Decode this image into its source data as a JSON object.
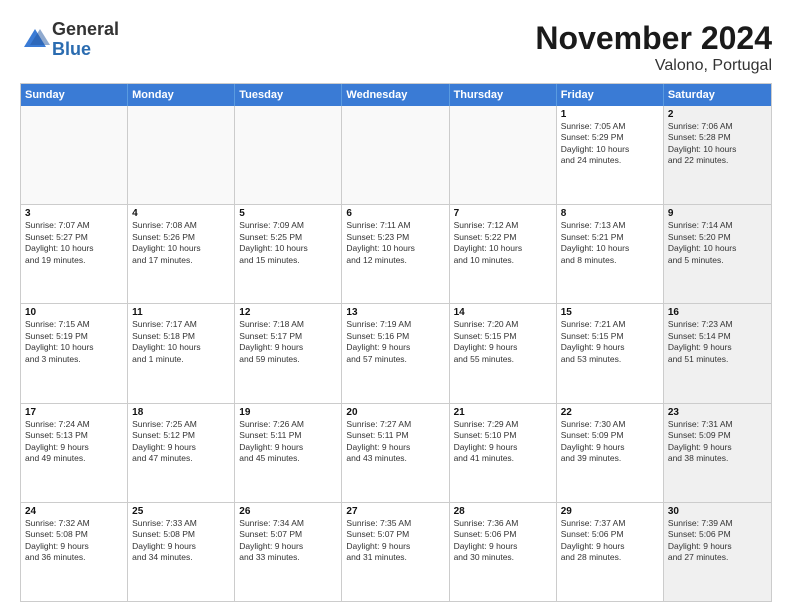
{
  "header": {
    "logo_general": "General",
    "logo_blue": "Blue",
    "month_title": "November 2024",
    "subtitle": "Valono, Portugal"
  },
  "days": [
    "Sunday",
    "Monday",
    "Tuesday",
    "Wednesday",
    "Thursday",
    "Friday",
    "Saturday"
  ],
  "rows": [
    [
      {
        "day": "",
        "empty": true
      },
      {
        "day": "",
        "empty": true
      },
      {
        "day": "",
        "empty": true
      },
      {
        "day": "",
        "empty": true
      },
      {
        "day": "",
        "empty": true
      },
      {
        "day": "1",
        "info": "Sunrise: 7:05 AM\nSunset: 5:29 PM\nDaylight: 10 hours\nand 24 minutes."
      },
      {
        "day": "2",
        "info": "Sunrise: 7:06 AM\nSunset: 5:28 PM\nDaylight: 10 hours\nand 22 minutes.",
        "shaded": true
      }
    ],
    [
      {
        "day": "3",
        "info": "Sunrise: 7:07 AM\nSunset: 5:27 PM\nDaylight: 10 hours\nand 19 minutes."
      },
      {
        "day": "4",
        "info": "Sunrise: 7:08 AM\nSunset: 5:26 PM\nDaylight: 10 hours\nand 17 minutes."
      },
      {
        "day": "5",
        "info": "Sunrise: 7:09 AM\nSunset: 5:25 PM\nDaylight: 10 hours\nand 15 minutes."
      },
      {
        "day": "6",
        "info": "Sunrise: 7:11 AM\nSunset: 5:23 PM\nDaylight: 10 hours\nand 12 minutes."
      },
      {
        "day": "7",
        "info": "Sunrise: 7:12 AM\nSunset: 5:22 PM\nDaylight: 10 hours\nand 10 minutes."
      },
      {
        "day": "8",
        "info": "Sunrise: 7:13 AM\nSunset: 5:21 PM\nDaylight: 10 hours\nand 8 minutes."
      },
      {
        "day": "9",
        "info": "Sunrise: 7:14 AM\nSunset: 5:20 PM\nDaylight: 10 hours\nand 5 minutes.",
        "shaded": true
      }
    ],
    [
      {
        "day": "10",
        "info": "Sunrise: 7:15 AM\nSunset: 5:19 PM\nDaylight: 10 hours\nand 3 minutes."
      },
      {
        "day": "11",
        "info": "Sunrise: 7:17 AM\nSunset: 5:18 PM\nDaylight: 10 hours\nand 1 minute."
      },
      {
        "day": "12",
        "info": "Sunrise: 7:18 AM\nSunset: 5:17 PM\nDaylight: 9 hours\nand 59 minutes."
      },
      {
        "day": "13",
        "info": "Sunrise: 7:19 AM\nSunset: 5:16 PM\nDaylight: 9 hours\nand 57 minutes."
      },
      {
        "day": "14",
        "info": "Sunrise: 7:20 AM\nSunset: 5:15 PM\nDaylight: 9 hours\nand 55 minutes."
      },
      {
        "day": "15",
        "info": "Sunrise: 7:21 AM\nSunset: 5:15 PM\nDaylight: 9 hours\nand 53 minutes."
      },
      {
        "day": "16",
        "info": "Sunrise: 7:23 AM\nSunset: 5:14 PM\nDaylight: 9 hours\nand 51 minutes.",
        "shaded": true
      }
    ],
    [
      {
        "day": "17",
        "info": "Sunrise: 7:24 AM\nSunset: 5:13 PM\nDaylight: 9 hours\nand 49 minutes."
      },
      {
        "day": "18",
        "info": "Sunrise: 7:25 AM\nSunset: 5:12 PM\nDaylight: 9 hours\nand 47 minutes."
      },
      {
        "day": "19",
        "info": "Sunrise: 7:26 AM\nSunset: 5:11 PM\nDaylight: 9 hours\nand 45 minutes."
      },
      {
        "day": "20",
        "info": "Sunrise: 7:27 AM\nSunset: 5:11 PM\nDaylight: 9 hours\nand 43 minutes."
      },
      {
        "day": "21",
        "info": "Sunrise: 7:29 AM\nSunset: 5:10 PM\nDaylight: 9 hours\nand 41 minutes."
      },
      {
        "day": "22",
        "info": "Sunrise: 7:30 AM\nSunset: 5:09 PM\nDaylight: 9 hours\nand 39 minutes."
      },
      {
        "day": "23",
        "info": "Sunrise: 7:31 AM\nSunset: 5:09 PM\nDaylight: 9 hours\nand 38 minutes.",
        "shaded": true
      }
    ],
    [
      {
        "day": "24",
        "info": "Sunrise: 7:32 AM\nSunset: 5:08 PM\nDaylight: 9 hours\nand 36 minutes."
      },
      {
        "day": "25",
        "info": "Sunrise: 7:33 AM\nSunset: 5:08 PM\nDaylight: 9 hours\nand 34 minutes."
      },
      {
        "day": "26",
        "info": "Sunrise: 7:34 AM\nSunset: 5:07 PM\nDaylight: 9 hours\nand 33 minutes."
      },
      {
        "day": "27",
        "info": "Sunrise: 7:35 AM\nSunset: 5:07 PM\nDaylight: 9 hours\nand 31 minutes."
      },
      {
        "day": "28",
        "info": "Sunrise: 7:36 AM\nSunset: 5:06 PM\nDaylight: 9 hours\nand 30 minutes."
      },
      {
        "day": "29",
        "info": "Sunrise: 7:37 AM\nSunset: 5:06 PM\nDaylight: 9 hours\nand 28 minutes."
      },
      {
        "day": "30",
        "info": "Sunrise: 7:39 AM\nSunset: 5:06 PM\nDaylight: 9 hours\nand 27 minutes.",
        "shaded": true
      }
    ]
  ]
}
